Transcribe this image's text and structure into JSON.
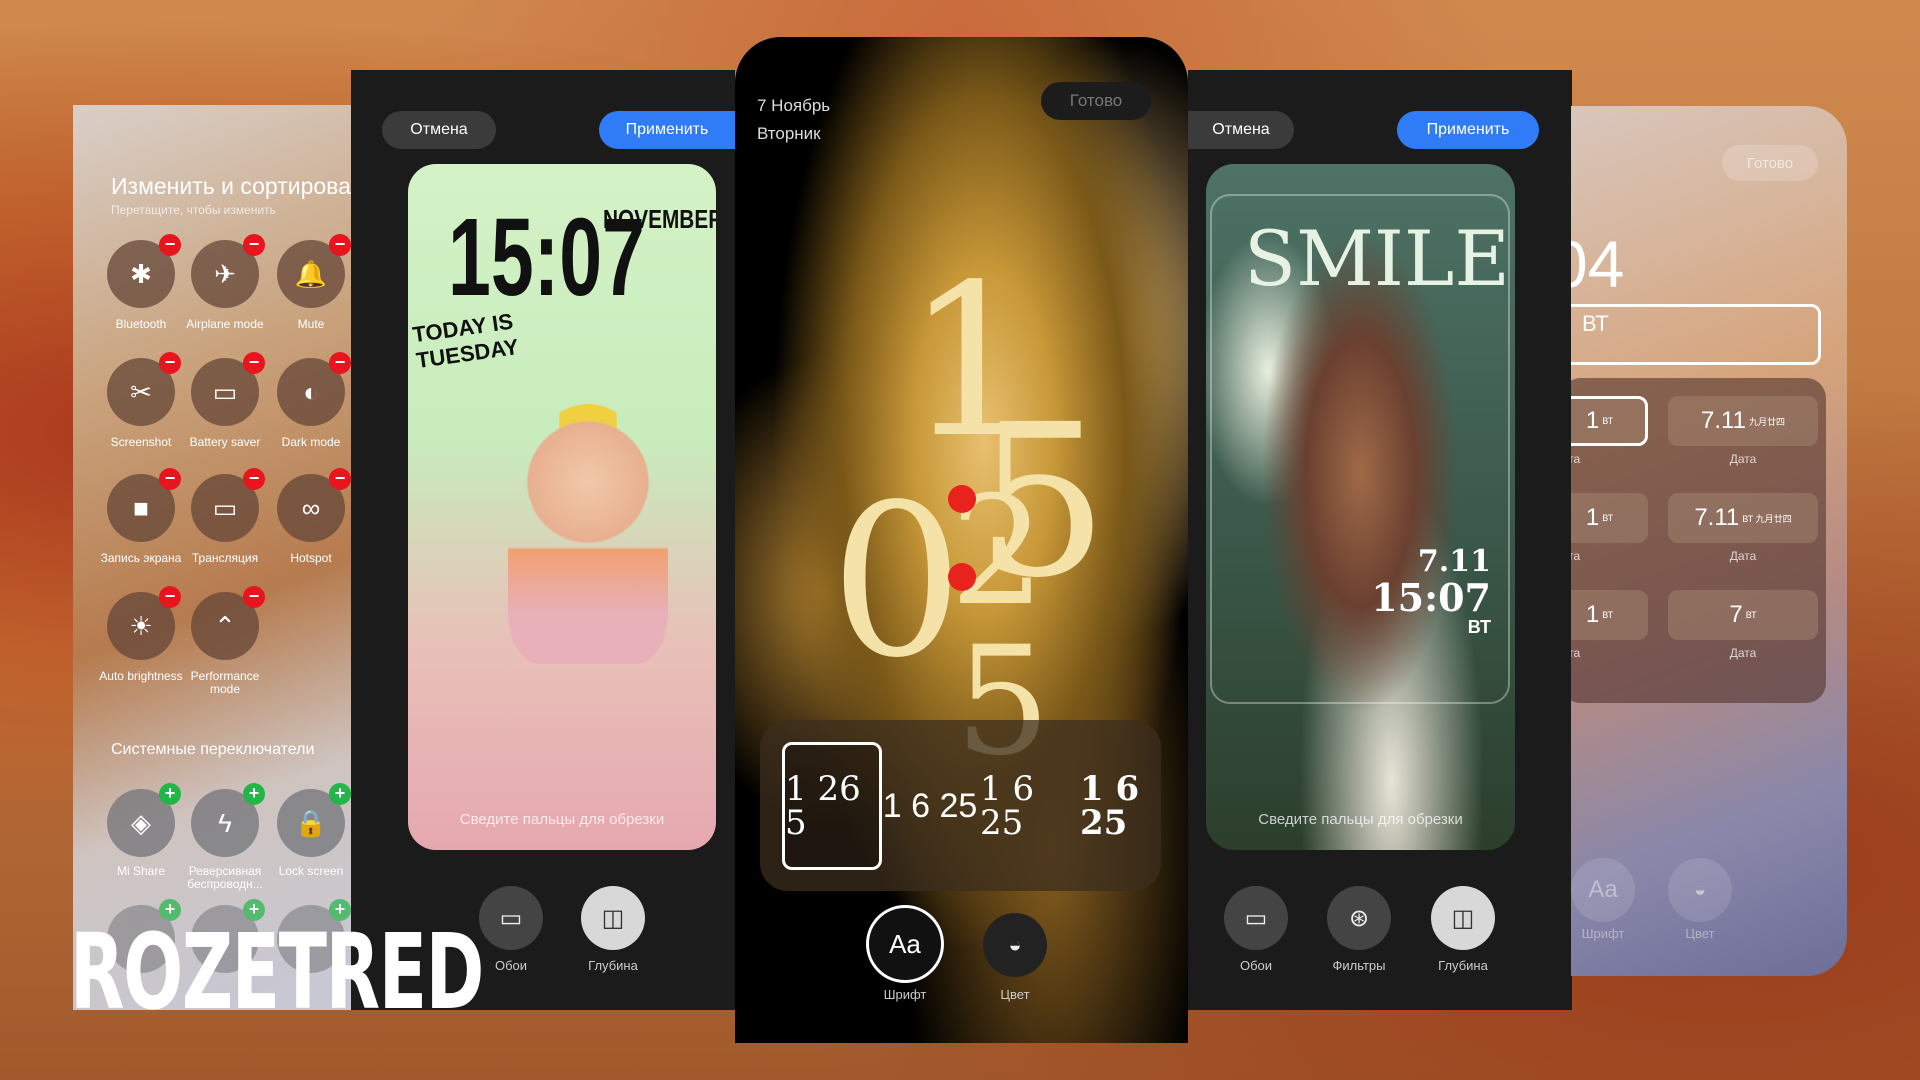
{
  "left_panel": {
    "title": "Изменить и сортировать",
    "subtitle": "Перетащите, чтобы изменить",
    "active_tiles": [
      {
        "label": "Bluetooth",
        "icon": "bluetooth-icon",
        "glyph": "✱"
      },
      {
        "label": "Airplane mode",
        "icon": "airplane-icon",
        "glyph": "✈"
      },
      {
        "label": "Mute",
        "icon": "bell-icon",
        "glyph": "🔔"
      },
      {
        "label": "Screenshot",
        "icon": "screenshot-icon",
        "glyph": "✂"
      },
      {
        "label": "Battery saver",
        "icon": "battery-icon",
        "glyph": "▭"
      },
      {
        "label": "Dark mode",
        "icon": "dark-mode-icon",
        "glyph": "◐"
      },
      {
        "label": "Запись экрана",
        "icon": "screen-record-icon",
        "glyph": "■"
      },
      {
        "label": "Трансляция",
        "icon": "cast-icon",
        "glyph": "▭"
      },
      {
        "label": "Hotspot",
        "icon": "hotspot-icon",
        "glyph": "∞"
      },
      {
        "label": "Auto brightness",
        "icon": "auto-brightness-icon",
        "glyph": "☀"
      },
      {
        "label": "Performance mode",
        "icon": "performance-icon",
        "glyph": "⌃"
      }
    ],
    "section_title": "Системные переключатели",
    "system_tiles": [
      {
        "label": "Mi Share",
        "icon": "mi-share-icon",
        "glyph": "◈"
      },
      {
        "label": "Реверсивная беспроводн...",
        "icon": "reverse-charging-icon",
        "glyph": "ϟ"
      },
      {
        "label": "Lock screen",
        "icon": "lock-icon",
        "glyph": "🔒"
      }
    ],
    "remove_badge": "−",
    "add_badge": "+"
  },
  "editor1": {
    "cancel": "Отмена",
    "apply": "Применить",
    "hint": "Сведите пальцы для обрезки",
    "art": {
      "month": "NOVEMBER",
      "time": "15:07",
      "day": "TODAY IS TUESDAY"
    },
    "buttons": [
      {
        "label": "Обои",
        "icon": "wallpaper-icon"
      },
      {
        "label": "Глубина",
        "icon": "depth-icon"
      }
    ]
  },
  "center": {
    "date": "7 Ноябрь",
    "weekday": "Вторник",
    "done": "Готово",
    "clock": {
      "h1": "1",
      "h2": "5",
      "m1": "0",
      "m2": "2",
      "extra": "5"
    },
    "styles": [
      "1 26 5",
      "1 6 25",
      "1 6 25",
      "1 6 25"
    ],
    "buttons": [
      {
        "label": "Шрифт",
        "icon": "font-icon",
        "glyph": "Aa"
      },
      {
        "label": "Цвет",
        "icon": "color-drop-icon",
        "glyph": "💧"
      }
    ],
    "accent": "#e8221c"
  },
  "editor2": {
    "cancel": "Отмена",
    "apply": "Применить",
    "hint": "Сведите пальцы для обрезки",
    "art": {
      "title": "SMILE",
      "date": "7.11",
      "time": "15:07",
      "day": "ВТ"
    },
    "buttons": [
      {
        "label": "Обои",
        "icon": "wallpaper-icon"
      },
      {
        "label": "Фильтры",
        "icon": "filters-icon"
      },
      {
        "label": "Глубина",
        "icon": "depth-icon"
      }
    ]
  },
  "right_panel": {
    "done": "Готово",
    "time_fragment": "04",
    "day_fragment": "ВТ",
    "cells": [
      {
        "left": "1",
        "left_sup": "ВТ",
        "left_label": "ата",
        "right": "7.11",
        "right_sup": "九月廿四",
        "right_label": "Дата"
      },
      {
        "left": "1",
        "left_sup": "ВТ",
        "left_label": "ата",
        "right": "7.11",
        "right_sup": "ВТ 九月廿四",
        "right_label": "Дата"
      },
      {
        "left": "1",
        "left_sup": "ВТ",
        "left_label": "ата",
        "right": "7",
        "right_sup": "ВТ",
        "right_label": "Дата"
      }
    ],
    "buttons": [
      {
        "label": "Шрифт",
        "glyph": "Aa"
      },
      {
        "label": "Цвет",
        "glyph": "💧"
      }
    ]
  },
  "watermark": "ROZETRED",
  "colors": {
    "apply_blue": "#2f7cf6",
    "remove_red": "#e8141e",
    "add_green": "#22b548"
  }
}
